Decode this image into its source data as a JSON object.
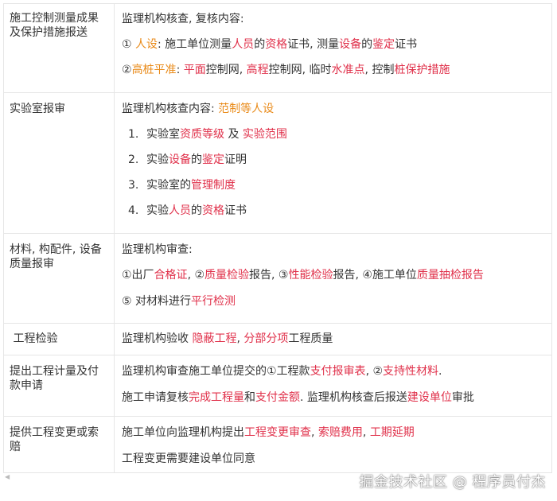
{
  "rows": [
    {
      "label": "施工控制测量成果及保护措施报送",
      "lines": [
        [
          {
            "t": "监理机构核查, 复核内容:"
          }
        ],
        [
          {
            "t": "① "
          },
          {
            "t": "人设",
            "c": "org"
          },
          {
            "t": ": 施工单位测量"
          },
          {
            "t": "人员",
            "c": "red"
          },
          {
            "t": "的"
          },
          {
            "t": "资格",
            "c": "red"
          },
          {
            "t": "证书,  测量"
          },
          {
            "t": "设备",
            "c": "red"
          },
          {
            "t": "的"
          },
          {
            "t": "鉴定",
            "c": "red"
          },
          {
            "t": "证书"
          }
        ],
        [
          {
            "t": "②"
          },
          {
            "t": "高桩平准",
            "c": "org"
          },
          {
            "t": ": "
          },
          {
            "t": "平面",
            "c": "red"
          },
          {
            "t": "控制网, "
          },
          {
            "t": "高程",
            "c": "red"
          },
          {
            "t": "控制网, 临时"
          },
          {
            "t": "水准点",
            "c": "red"
          },
          {
            "t": ", 控制"
          },
          {
            "t": "桩保护措施",
            "c": "red"
          }
        ]
      ]
    },
    {
      "label": "实验室报审",
      "lines": [
        [
          {
            "t": "监理机构核查内容:  "
          },
          {
            "t": "范制等人设",
            "c": "org"
          }
        ],
        [
          {
            "t": "1.",
            "n": 1
          },
          {
            "t": "实验室"
          },
          {
            "t": "资质等级",
            "c": "red"
          },
          {
            "t": " 及 "
          },
          {
            "t": "实验范围",
            "c": "red"
          }
        ],
        [
          {
            "t": "2.",
            "n": 1
          },
          {
            "t": "实验"
          },
          {
            "t": "设备",
            "c": "red"
          },
          {
            "t": "的"
          },
          {
            "t": "鉴定",
            "c": "red"
          },
          {
            "t": "证明"
          }
        ],
        [
          {
            "t": "3.",
            "n": 1
          },
          {
            "t": "实验室的"
          },
          {
            "t": "管理制度",
            "c": "red"
          }
        ],
        [
          {
            "t": "4.",
            "n": 1
          },
          {
            "t": "实验"
          },
          {
            "t": "人员",
            "c": "red"
          },
          {
            "t": "的"
          },
          {
            "t": "资格",
            "c": "red"
          },
          {
            "t": "证书"
          }
        ]
      ]
    },
    {
      "label": "材料, 构配件, 设备质量报审",
      "lines": [
        [
          {
            "t": "监理机构审查:"
          }
        ],
        [
          {
            "t": "①出厂"
          },
          {
            "t": "合格证",
            "c": "red"
          },
          {
            "t": ", ②"
          },
          {
            "t": "质量检验",
            "c": "red"
          },
          {
            "t": "报告, ③"
          },
          {
            "t": "性能检验",
            "c": "red"
          },
          {
            "t": "报告, ④施工单位"
          },
          {
            "t": "质量抽检报告",
            "c": "red"
          }
        ],
        [
          {
            "t": "⑤ 对材料进行"
          },
          {
            "t": "平行检测",
            "c": "red"
          }
        ]
      ]
    },
    {
      "label": " 工程检验",
      "lines": [
        [
          {
            "t": "监理机构验收 "
          },
          {
            "t": "隐蔽工程",
            "c": "red"
          },
          {
            "t": ", "
          },
          {
            "t": "分部分项",
            "c": "red"
          },
          {
            "t": "工程质量"
          }
        ]
      ]
    },
    {
      "label": "提出工程计量及付款申请",
      "lines": [
        [
          {
            "t": "监理机构审查施工单位提交的①工程款"
          },
          {
            "t": "支付报审表",
            "c": "red"
          },
          {
            "t": ", ②"
          },
          {
            "t": "支持性材料",
            "c": "red"
          },
          {
            "t": "."
          }
        ],
        [
          {
            "t": "施工申请复核"
          },
          {
            "t": "完成工程量",
            "c": "red"
          },
          {
            "t": "和"
          },
          {
            "t": "支付金额",
            "c": "red"
          },
          {
            "t": ". 监理机构核查后报送"
          },
          {
            "t": "建设单位",
            "c": "red"
          },
          {
            "t": "审批"
          }
        ]
      ]
    },
    {
      "label": "提供工程变更或索赔",
      "lines": [
        [
          {
            "t": "施工单位向监理机构提出"
          },
          {
            "t": "工程变更审查",
            "c": "red"
          },
          {
            "t": ", "
          },
          {
            "t": "索赔费用",
            "c": "red"
          },
          {
            "t": ", "
          },
          {
            "t": "工期延期",
            "c": "red"
          }
        ],
        [
          {
            "t": "工程变更需要建设单位同意"
          }
        ]
      ]
    }
  ],
  "watermark": "掘金技术社区 @ 程序员付杰",
  "colors": {
    "red": "#e0304a",
    "orange": "#e98a18",
    "text": "#333333",
    "border": "#e6e6e6"
  }
}
